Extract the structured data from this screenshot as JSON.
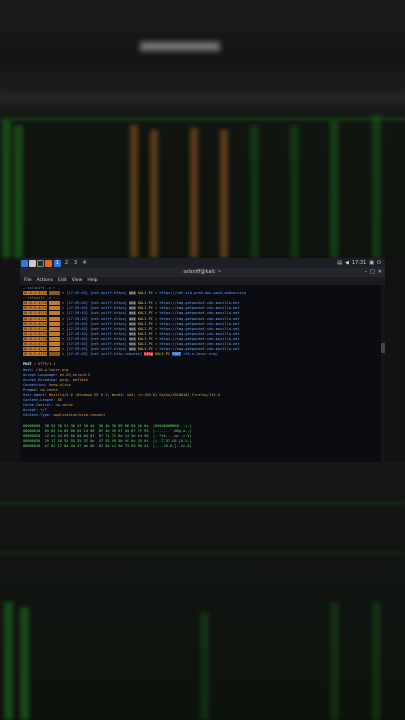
{
  "panel": {
    "workspaces": [
      "1",
      "2",
      "3",
      "4"
    ],
    "active_workspace": "1",
    "clock": "17:31",
    "icons": [
      "kali-menu-icon",
      "files-icon",
      "terminal-icon",
      "firefox-icon"
    ]
  },
  "window": {
    "title": "sslsniff@kali: ~",
    "menu": [
      "File",
      "Actions",
      "Edit",
      "View",
      "Help"
    ]
  },
  "terminal": {
    "prompt": "— sslsniff -c ~ —",
    "first_line": {
      "ip": "10.0.2.4/24",
      "time": "[17:29:43]",
      "proto": "[net.sniff.https]",
      "tag": "sni",
      "host": "KALI-PC",
      "url": "https://cdn-slb.prod.aws.paid.webservice"
    },
    "second_prompt": "— sslsniff -c ~ —",
    "sni_rows": [
      {
        "ip": "10.0.2.4/24",
        "time": "[17:29:43]",
        "url": "https://img-getpocket.cdn.mozilla.net"
      },
      {
        "ip": "10.0.2.4/24",
        "time": "[17:29:43]",
        "url": "https://img-getpocket.cdn.mozilla.net"
      },
      {
        "ip": "10.0.2.4/24",
        "time": "[17:29:43]",
        "url": "https://img-getpocket.cdn.mozilla.net"
      },
      {
        "ip": "10.0.2.4/24",
        "time": "[17:29:43]",
        "url": "https://img-getpocket.cdn.mozilla.net"
      },
      {
        "ip": "10.0.2.4/24",
        "time": "[17:29:43]",
        "url": "https://img-getpocket.cdn.mozilla.net"
      },
      {
        "ip": "10.0.2.4/24",
        "time": "[17:29:43]",
        "url": "https://img-getpocket.cdn.mozilla.net"
      },
      {
        "ip": "10.0.2.4/24",
        "time": "[17:29:43]",
        "url": "https://img-getpocket.cdn.mozilla.net"
      },
      {
        "ip": "10.0.2.4/24",
        "time": "[17:29:43]",
        "url": "https://img-getpocket.cdn.mozilla.net"
      },
      {
        "ip": "10.0.2.4/24",
        "time": "[17:29:43]",
        "url": "https://img-getpocket.cdn.mozilla.net"
      },
      {
        "ip": "10.0.2.4/24",
        "time": "[17:29:43]",
        "url": "https://img-getpocket.cdn.mozilla.net"
      }
    ],
    "sni_proto": "[net.sniff.https]",
    "sni_tag": "sni",
    "sni_host": "KALI-PC",
    "request_line": {
      "ip": "10.0.2.4/24",
      "time": "[17:29:43]",
      "proto": "[net.sniff.http.request]",
      "tag1": "http",
      "host": "KALI-PC",
      "tag2": "POST",
      "url": "r10.o.lencr.org/"
    },
    "http": [
      {
        "key": "POST",
        "val": "/ HTTP/1.1",
        "cls": "w"
      },
      {
        "key": "Host:",
        "val": "r10.o.lencr.org",
        "cls": "b"
      },
      {
        "key": "Accept-Language:",
        "val": "en-US,en;q=0.5",
        "cls": "b"
      },
      {
        "key": "Accept-Encoding:",
        "val": "gzip, deflate",
        "cls": "b"
      },
      {
        "key": "Connection:",
        "val": "keep-alive",
        "cls": "b"
      },
      {
        "key": "Pragma:",
        "val": "no-cache",
        "cls": "b"
      },
      {
        "key": "User-Agent:",
        "val": "Mozilla/5.0 (Windows NT 6.1; Win64; x64; rv:109.0) Gecko/20100101 Firefox/115.0",
        "cls": "b"
      },
      {
        "key": "Content-Length:",
        "val": "85",
        "cls": "b"
      },
      {
        "key": "Cache-Control:",
        "val": "no-cache",
        "cls": "b"
      },
      {
        "key": "Accept:",
        "val": "*/*",
        "cls": "b"
      },
      {
        "key": "Content-Type:",
        "val": "application/ocsp-request",
        "cls": "b"
      }
    ],
    "hexdump": [
      "00000000  30 53 30 51 30 4f 30 4d  30 4b 30 09 06 05 2b 0e  |0S0Q0O0M0K0...+.|",
      "00000010  03 02 1a 05 00 04 14 60  0f 4e 35 67 d4 6f 7f 95  |.......`.N5g.o..|",
      "00000020  c2 e1 2a 69 6b 04 04 0f  87 71 72 0a 14 3e e4 56  |..*ik....qr..>.V|",
      "00000030  29 17 10 54 93 35 37 0e  47 45 f8 5b 4f 0c 25 0f  |)..T.57.GE.[O.%.|",
      "00000040  e7 82 17 0a 4a 47 ae 4b  02 5d c1 9e 73 63 96 41  |....JG.K.]..sc.A|"
    ]
  }
}
